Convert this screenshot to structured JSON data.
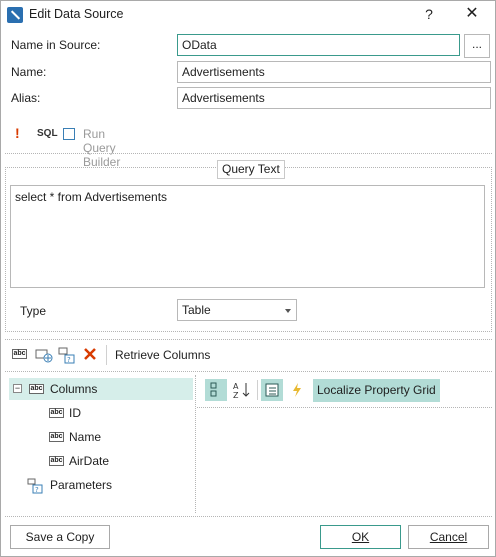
{
  "window": {
    "title": "Edit Data Source",
    "help_label": "?",
    "close_label": "✕"
  },
  "fields": {
    "name_in_source_label": "Name in Source:",
    "name_in_source_value": "OData",
    "browse_label": "...",
    "name_label": "Name:",
    "name_value": "Advertisements",
    "alias_label": "Alias:",
    "alias_value": "Advertisements"
  },
  "query_toolbar": {
    "warning_glyph": "!",
    "sql_label": "SQL",
    "run_query_builder_label": "Run Query Builder"
  },
  "query_group": {
    "caption": "Query Text",
    "query_text": "select * from Advertisements",
    "type_label": "Type",
    "type_value": "Table"
  },
  "columns_toolbar": {
    "retrieve_columns_label": "Retrieve Columns"
  },
  "tree": {
    "collapse_glyph": "−",
    "columns_label": "Columns",
    "items": [
      {
        "label": "ID"
      },
      {
        "label": "Name"
      },
      {
        "label": "AirDate"
      }
    ],
    "parameters_label": "Parameters"
  },
  "property_grid": {
    "localize_label": "Localize Property Grid"
  },
  "footer": {
    "save_copy_label": "Save a Copy",
    "ok_label": "OK",
    "cancel_label": "Cancel"
  },
  "colors": {
    "accent": "#3a9a8c",
    "selection": "#d6eeea",
    "toggle_on": "#b2dcd6",
    "warning": "#d83b01",
    "disabled_text": "#9a9a9a"
  }
}
